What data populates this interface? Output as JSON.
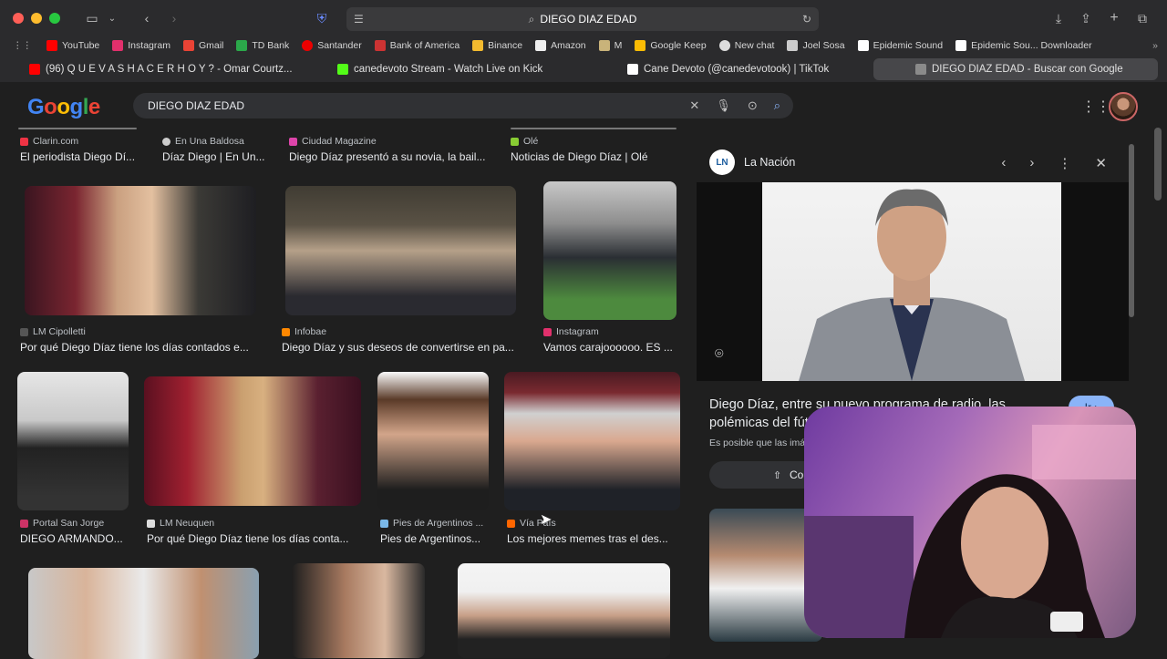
{
  "browser": {
    "url": "DIEGO DIAZ EDAD",
    "bookmarks": [
      "YouTube",
      "Instagram",
      "Gmail",
      "TD Bank",
      "Santander",
      "Bank of America",
      "Binance",
      "Amazon",
      "M",
      "Google Keep",
      "New chat",
      "Joel Sosa",
      "Epidemic Sound",
      "Epidemic Sou... Downloader"
    ],
    "tabs": [
      {
        "label": "(96) Q U E V A S H A C E R H O Y ? - Omar Courtz...",
        "color": "#ff0000"
      },
      {
        "label": "canedevoto Stream - Watch Live on Kick",
        "color": "#53fc18"
      },
      {
        "label": "Cane Devoto (@canedevotook) | TikTok",
        "color": "#ffffff"
      },
      {
        "label": "DIEGO DIAZ EDAD - Buscar con Google",
        "color": "#8a8a8a"
      }
    ]
  },
  "google": {
    "logo": "Google",
    "query": "DIEGO DIAZ EDAD"
  },
  "results": {
    "row0": [
      {
        "source": "Clarin.com",
        "title": "El periodista Diego Dí..."
      },
      {
        "source": "En Una Baldosa",
        "title": "Díaz Diego | En Un..."
      },
      {
        "source": "Ciudad Magazine",
        "title": "Diego Díaz presentó a su novia, la bail..."
      },
      {
        "source": "Olé",
        "title": "Noticias de Diego Díaz | Olé"
      }
    ],
    "row1": [
      {
        "source": "LM Cipolletti",
        "title": "Por qué Diego Díaz tiene los días contados e..."
      },
      {
        "source": "Infobae",
        "title": "Diego Díaz y sus deseos de convertirse en pa..."
      },
      {
        "source": "Instagram",
        "title": "Vamos carajoooooo. ES ..."
      }
    ],
    "row2": [
      {
        "source": "Portal San Jorge",
        "title": "DIEGO ARMANDO..."
      },
      {
        "source": "LM Neuquen",
        "title": "Por qué Diego Díaz tiene los días conta..."
      },
      {
        "source": "Pies de Argentinos ...",
        "title": "Pies de Argentinos..."
      },
      {
        "source": "Vía País",
        "title": "Los mejores memes tras el des..."
      }
    ]
  },
  "panel": {
    "source": "La Nación",
    "source_logo": "LN",
    "title": "Diego Díaz, entre su nuevo programa de radio, las polémicas del fútbol",
    "subtitle": "Es posible que las imáge",
    "go_button": "Ir",
    "share_button": "Co"
  }
}
